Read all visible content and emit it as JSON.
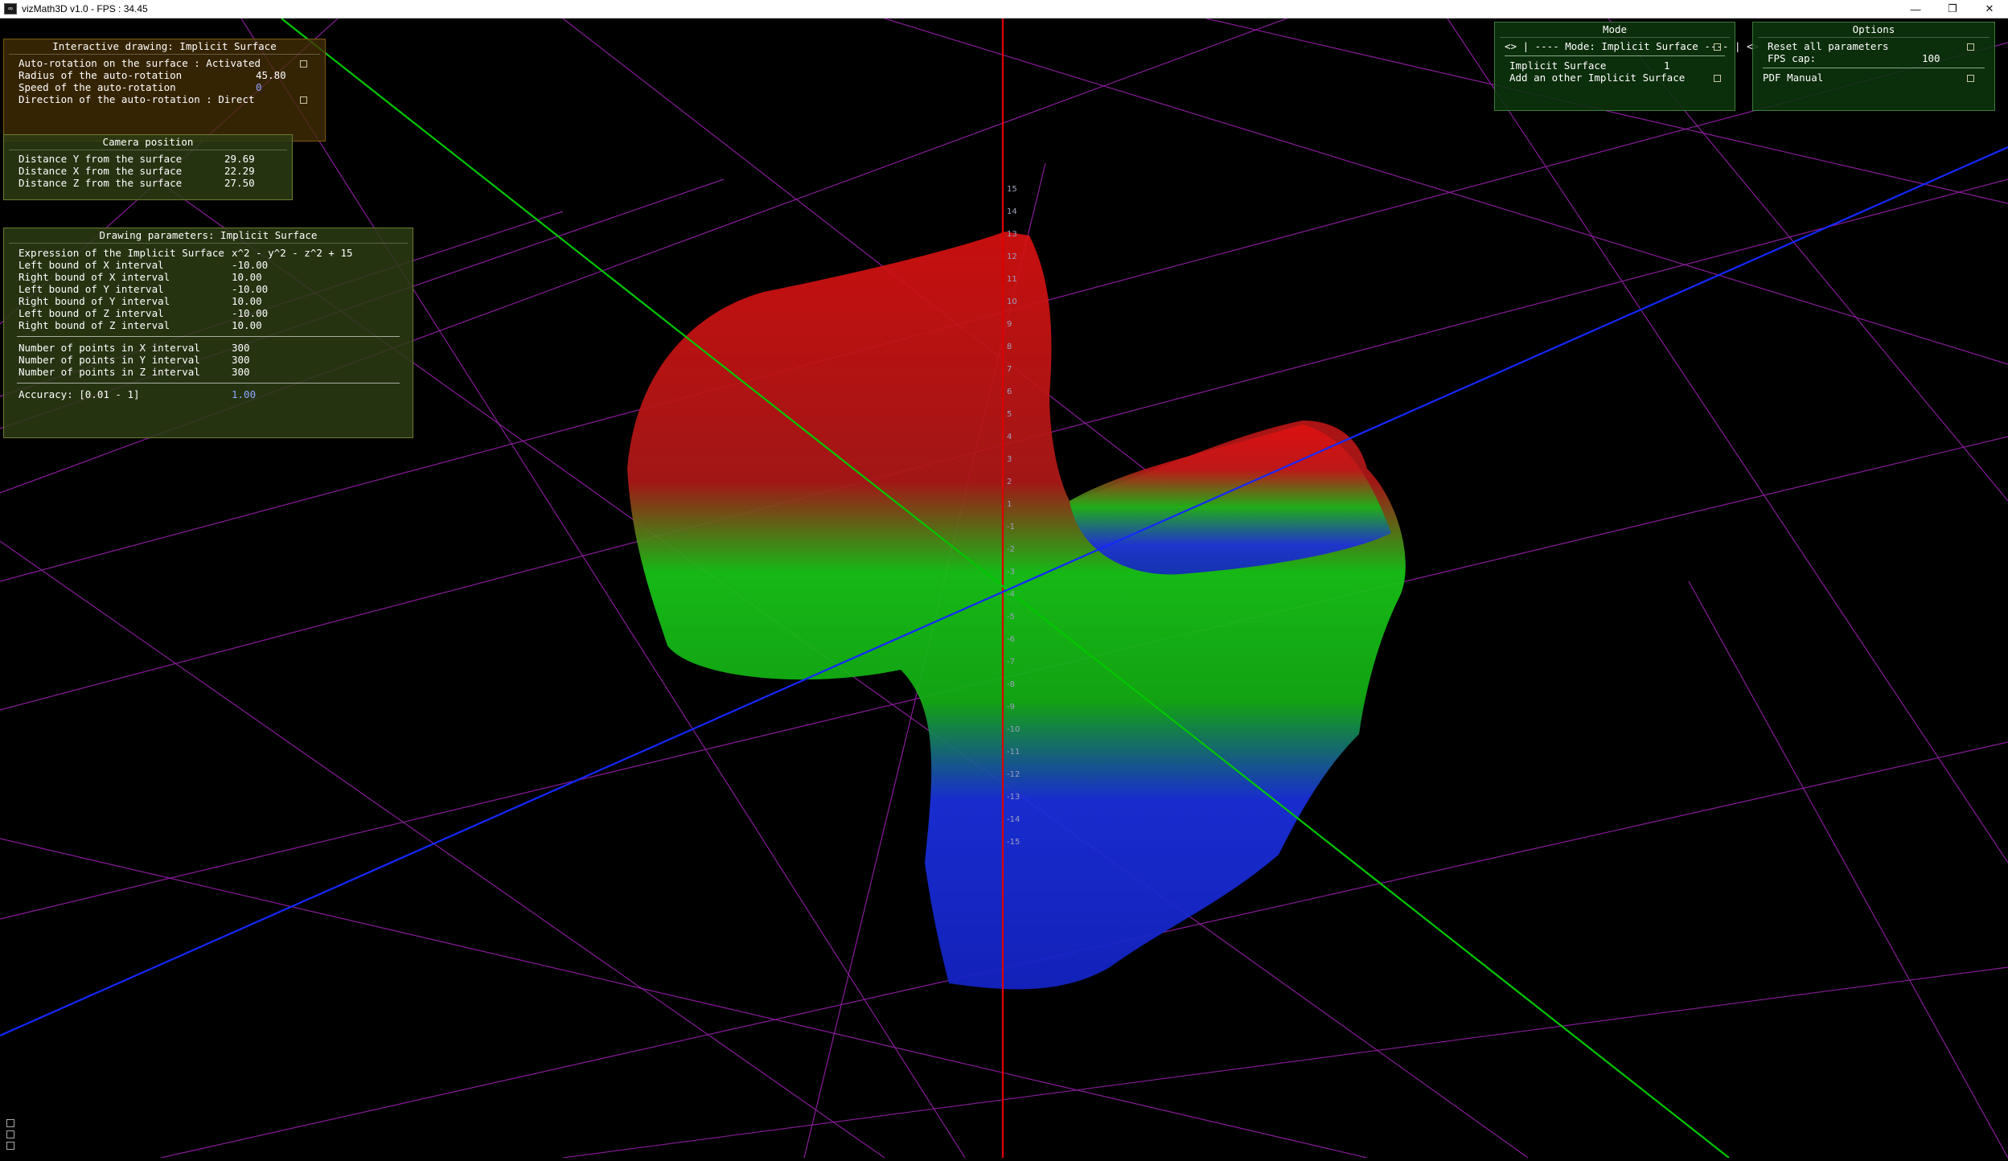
{
  "window": {
    "title": "vizMath3D v1.0 - FPS : 34.45",
    "icon": "vizmath-app-icon",
    "controls": [
      "minimize-icon",
      "restore-icon",
      "close-icon"
    ]
  },
  "interactive_panel": {
    "title": "Interactive drawing: Implicit Surface",
    "auto_rotation_label": "Auto-rotation on the surface : Activated",
    "radius_label": "Radius of the auto-rotation",
    "radius_value": "45.80",
    "speed_label": "Speed of the auto-rotation",
    "speed_value": "0",
    "direction_label": "Direction of the auto-rotation : Direct"
  },
  "camera_panel": {
    "title": "Camera position",
    "rows": [
      {
        "label": "Distance Y from the surface",
        "value": "29.69"
      },
      {
        "label": "Distance X from the surface",
        "value": "22.29"
      },
      {
        "label": "Distance Z from the surface",
        "value": "27.50"
      }
    ]
  },
  "drawing_panel": {
    "title": "Drawing parameters: Implicit Surface",
    "expression_label": "Expression of the Implicit Surface",
    "expression_value": "x^2 - y^2 - z^2 + 15",
    "bounds": [
      {
        "label": "Left bound of X interval",
        "value": "-10.00"
      },
      {
        "label": "Right bound of X interval",
        "value": "10.00"
      },
      {
        "label": "Left bound of Y interval",
        "value": "-10.00"
      },
      {
        "label": "Right bound of Y interval",
        "value": "10.00"
      },
      {
        "label": "Left bound of Z interval",
        "value": "-10.00"
      },
      {
        "label": "Right bound of Z interval",
        "value": "10.00"
      }
    ],
    "points": [
      {
        "label": "Number of points in X interval",
        "value": "300"
      },
      {
        "label": "Number of points in Y interval",
        "value": "300"
      },
      {
        "label": "Number of points in Z interval",
        "value": "300"
      }
    ],
    "accuracy_label": "Accuracy: [0.01 - 1]",
    "accuracy_value": "1.00"
  },
  "mode_panel": {
    "title": "Mode",
    "mode_selector": "<> | ---- Mode: Implicit Surface ---- | <>",
    "surface_label": "Implicit Surface",
    "surface_count": "1",
    "add_label": "Add an other Implicit Surface"
  },
  "options_panel": {
    "title": "Options",
    "reset_label": "Reset all parameters",
    "fps_label": "FPS cap:",
    "fps_value": "100",
    "manual_label": "PDF Manual"
  },
  "axis_ticks": [
    "15",
    "14",
    "13",
    "12",
    "11",
    "10",
    "9",
    "8",
    "7",
    "6",
    "5",
    "4",
    "3",
    "2",
    "1",
    "-1",
    "-2",
    "-3",
    "-4",
    "-5",
    "-6",
    "-7",
    "-8",
    "-9",
    "-10",
    "-11",
    "-12",
    "-13",
    "-14",
    "-15"
  ],
  "colors": {
    "x_axis": "#00c800",
    "y_axis": "#e00000",
    "z_axis": "#1428ff",
    "grid": "#b422c8",
    "surface_top": "#e01010",
    "surface_mid": "#10d010",
    "surface_bottom": "#1020f0"
  }
}
